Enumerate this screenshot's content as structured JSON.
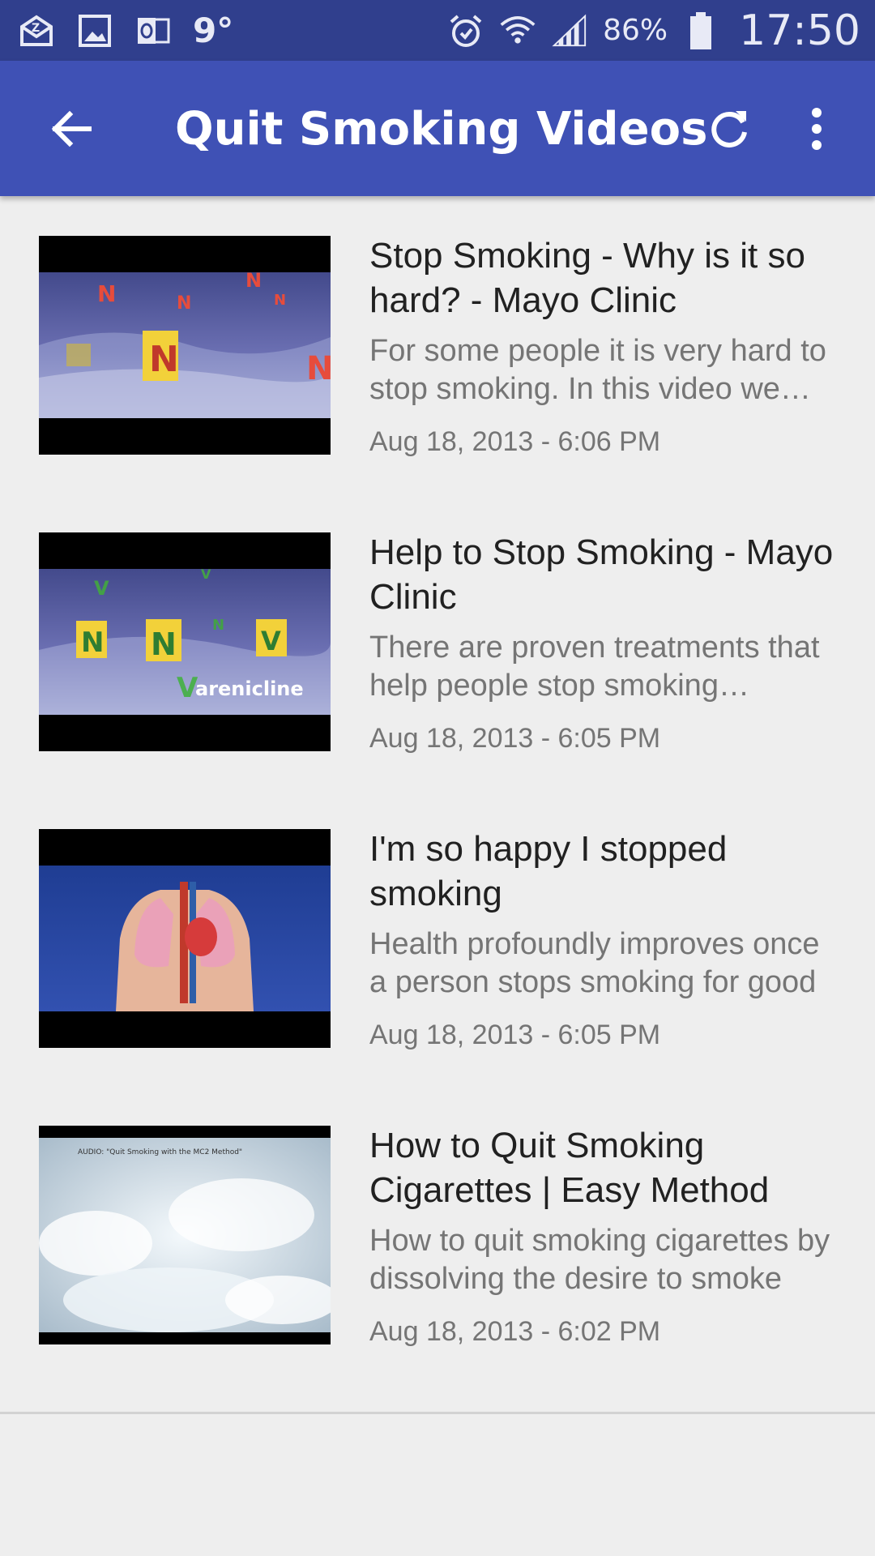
{
  "status_bar": {
    "temperature": "9°",
    "battery_percent": "86%",
    "time": "17:50",
    "left_icons": [
      "email-icon",
      "gallery-icon",
      "outlook-icon"
    ],
    "right_icons": [
      "alarm-icon",
      "wifi-icon",
      "signal-icon",
      "battery-icon"
    ]
  },
  "app_bar": {
    "title": "Quit Smoking Videos",
    "color": "#3f51b5",
    "status_color": "#303f8d"
  },
  "videos": [
    {
      "title": "Stop Smoking - Why is it so hard? - Mayo Clinic",
      "description": "For some people it is very hard to stop smoking.  In this video we explain why nicotine is so addictive",
      "date": "Aug 18, 2013 - 6:06 PM",
      "thumbnail_icon": "nicotine-receptors-thumbnail"
    },
    {
      "title": "Help to Stop Smoking - Mayo Clinic",
      "description": "There are proven treatments that help people stop smoking successfully",
      "date": "Aug 18, 2013 - 6:05 PM",
      "thumbnail_icon": "varenicline-thumbnail",
      "thumbnail_caption": "Varenicline"
    },
    {
      "title": "I'm so happy I stopped smoking",
      "description": "Health profoundly improves once a person stops smoking for good",
      "date": "Aug 18, 2013 - 6:05 PM",
      "thumbnail_icon": "lungs-heart-thumbnail"
    },
    {
      "title": "How to Quit Smoking Cigarettes | Easy Method",
      "description": "How to quit smoking cigarettes by dissolving the desire to smoke",
      "date": "Aug 18, 2013 - 6:02 PM",
      "thumbnail_icon": "clouds-thumbnail",
      "thumbnail_caption": "AUDIO: \"Quit Smoking with the MC2 Method\""
    }
  ]
}
